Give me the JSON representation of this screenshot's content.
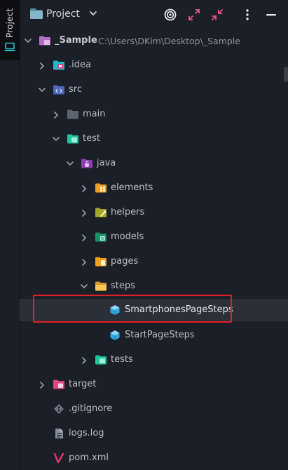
{
  "sidebar": {
    "tab_label": "Project"
  },
  "header": {
    "title": "Project"
  },
  "tree": {
    "root": {
      "label": "_Sample",
      "path": "C:\\Users\\DKim\\Desktop\\_Sample"
    },
    "idea": {
      "label": ".idea"
    },
    "src": {
      "label": "src"
    },
    "main": {
      "label": "main"
    },
    "test": {
      "label": "test"
    },
    "java": {
      "label": "java"
    },
    "elements": {
      "label": "elements"
    },
    "helpers": {
      "label": "helpers"
    },
    "models": {
      "label": "models"
    },
    "pages": {
      "label": "pages"
    },
    "steps": {
      "label": "steps"
    },
    "smartphones_page_steps": {
      "label": "SmartphonesPageSteps"
    },
    "start_page_steps": {
      "label": "StartPageSteps"
    },
    "tests": {
      "label": "tests"
    },
    "target": {
      "label": "target"
    },
    "gitignore": {
      "label": ".gitignore"
    },
    "logs": {
      "label": "logs.log"
    },
    "pom": {
      "label": "pom.xml"
    }
  },
  "colors": {
    "background": "#1b1f27",
    "selection": "#2a2f38",
    "highlight_border": "#e21f26",
    "change_marker": "#26d6a8"
  }
}
